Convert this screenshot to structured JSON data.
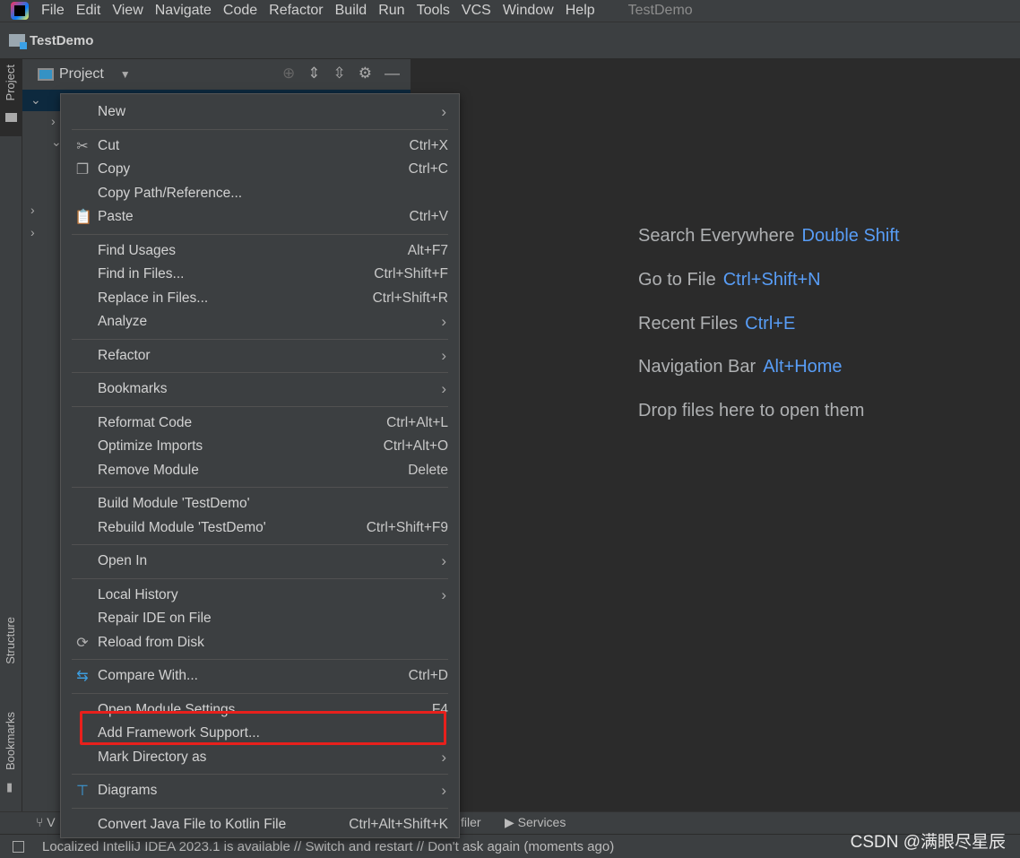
{
  "menubar": {
    "items": [
      "File",
      "Edit",
      "View",
      "Navigate",
      "Code",
      "Refactor",
      "Build",
      "Run",
      "Tools",
      "VCS",
      "Window",
      "Help"
    ],
    "title": "TestDemo"
  },
  "navbar": {
    "project": "TestDemo"
  },
  "side": {
    "project": "Project",
    "structure": "Structure",
    "bookmarks": "Bookmarks"
  },
  "panel": {
    "title": "Project"
  },
  "editor": {
    "hints": [
      {
        "label": "Search Everywhere",
        "key": "Double Shift"
      },
      {
        "label": "Go to File",
        "key": "Ctrl+Shift+N"
      },
      {
        "label": "Recent Files",
        "key": "Ctrl+E"
      },
      {
        "label": "Navigation Bar",
        "key": "Alt+Home"
      },
      {
        "label": "Drop files here to open them",
        "key": ""
      }
    ]
  },
  "context_menu": [
    {
      "label": "New",
      "sub": true
    },
    "sep",
    {
      "label": "Cut",
      "shortcut": "Ctrl+X",
      "icon": "scissors-icon"
    },
    {
      "label": "Copy",
      "shortcut": "Ctrl+C",
      "icon": "copy-icon"
    },
    {
      "label": "Copy Path/Reference..."
    },
    {
      "label": "Paste",
      "shortcut": "Ctrl+V",
      "icon": "paste-icon"
    },
    "sep",
    {
      "label": "Find Usages",
      "shortcut": "Alt+F7"
    },
    {
      "label": "Find in Files...",
      "shortcut": "Ctrl+Shift+F"
    },
    {
      "label": "Replace in Files...",
      "shortcut": "Ctrl+Shift+R"
    },
    {
      "label": "Analyze",
      "sub": true
    },
    "sep",
    {
      "label": "Refactor",
      "sub": true
    },
    "sep",
    {
      "label": "Bookmarks",
      "sub": true
    },
    "sep",
    {
      "label": "Reformat Code",
      "shortcut": "Ctrl+Alt+L"
    },
    {
      "label": "Optimize Imports",
      "shortcut": "Ctrl+Alt+O"
    },
    {
      "label": "Remove Module",
      "shortcut": "Delete"
    },
    "sep",
    {
      "label": "Build Module 'TestDemo'"
    },
    {
      "label": "Rebuild Module 'TestDemo'",
      "shortcut": "Ctrl+Shift+F9"
    },
    "sep",
    {
      "label": "Open In",
      "sub": true
    },
    "sep",
    {
      "label": "Local History",
      "sub": true
    },
    {
      "label": "Repair IDE on File"
    },
    {
      "label": "Reload from Disk",
      "icon": "reload-icon"
    },
    "sep",
    {
      "label": "Compare With...",
      "shortcut": "Ctrl+D",
      "icon": "compare-icon"
    },
    "sep",
    {
      "label": "Open Module Settings",
      "shortcut": "F4"
    },
    {
      "label": "Add Framework Support...",
      "highlighted": true
    },
    {
      "label": "Mark Directory as",
      "sub": true
    },
    "sep",
    {
      "label": "Diagrams",
      "sub": true,
      "icon": "diagram-icon"
    },
    "sep",
    {
      "label": "Convert Java File to Kotlin File",
      "shortcut": "Ctrl+Alt+Shift+K"
    }
  ],
  "toolbar": {
    "vcs": "V",
    "profiler": "filer",
    "services": "Services"
  },
  "status": {
    "message": "Localized IntelliJ IDEA 2023.1 is available // Switch and restart // Don't ask again (moments ago)"
  },
  "watermark": "CSDN @满眼尽星辰",
  "colors": {
    "accent": "#589df6",
    "highlight_box": "#e8201c"
  }
}
